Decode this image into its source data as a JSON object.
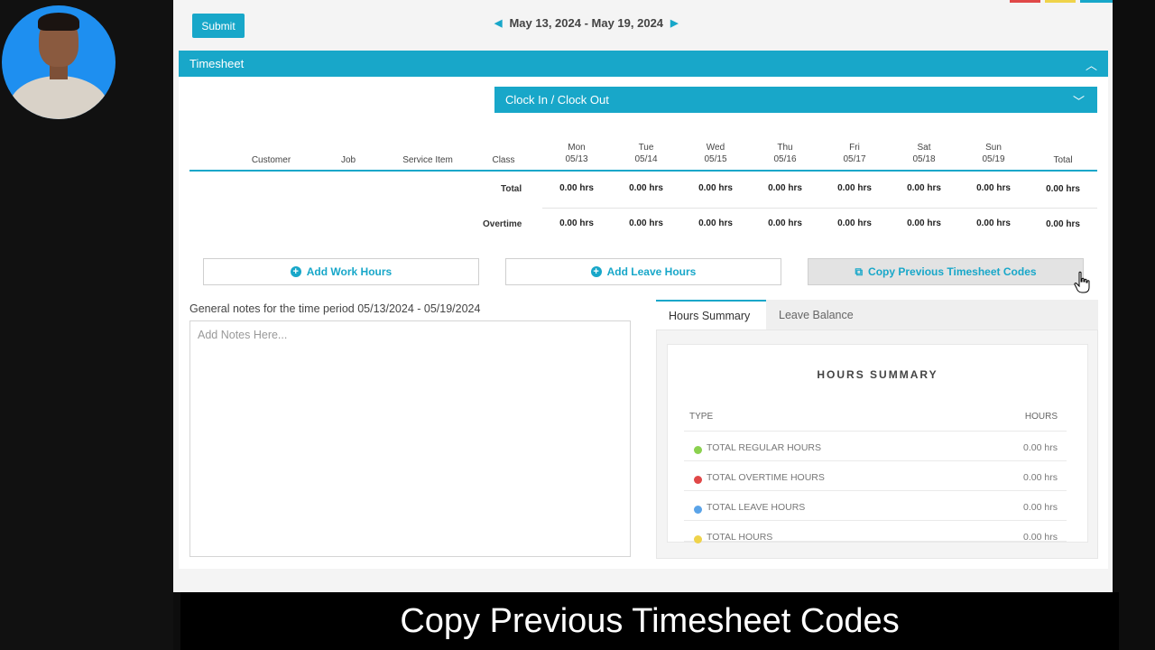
{
  "toolbar": {
    "submit_label": "Submit",
    "date_range": "May 13, 2024 - May 19, 2024"
  },
  "timesheet": {
    "title": "Timesheet",
    "clock_label": "Clock In / Clock Out",
    "columns": {
      "customer": "Customer",
      "job": "Job",
      "service_item": "Service Item",
      "class": "Class",
      "days": [
        {
          "day": "Mon",
          "date": "05/13"
        },
        {
          "day": "Tue",
          "date": "05/14"
        },
        {
          "day": "Wed",
          "date": "05/15"
        },
        {
          "day": "Thu",
          "date": "05/16"
        },
        {
          "day": "Fri",
          "date": "05/17"
        },
        {
          "day": "Sat",
          "date": "05/18"
        },
        {
          "day": "Sun",
          "date": "05/19"
        }
      ],
      "total": "Total"
    },
    "rows": [
      {
        "label": "Total",
        "values": [
          "0.00 hrs",
          "0.00 hrs",
          "0.00 hrs",
          "0.00 hrs",
          "0.00 hrs",
          "0.00 hrs",
          "0.00 hrs",
          "0.00 hrs"
        ]
      },
      {
        "label": "Overtime",
        "values": [
          "0.00 hrs",
          "0.00 hrs",
          "0.00 hrs",
          "0.00 hrs",
          "0.00 hrs",
          "0.00 hrs",
          "0.00 hrs",
          "0.00 hrs"
        ]
      }
    ],
    "actions": {
      "add_work": "Add Work Hours",
      "add_leave": "Add Leave Hours",
      "copy_previous": "Copy Previous Timesheet Codes"
    },
    "notes": {
      "label": "General notes for the time period 05/13/2024 - 05/19/2024",
      "placeholder": "Add Notes Here..."
    }
  },
  "summary": {
    "tabs": [
      "Hours Summary",
      "Leave Balance"
    ],
    "title": "HOURS SUMMARY",
    "head_type": "TYPE",
    "head_hours": "HOURS",
    "rows": [
      {
        "label": "TOTAL REGULAR HOURS",
        "value": "0.00 hrs",
        "color": "#8bd14f"
      },
      {
        "label": "TOTAL OVERTIME HOURS",
        "value": "0.00 hrs",
        "color": "#e04848"
      },
      {
        "label": "TOTAL LEAVE HOURS",
        "value": "0.00 hrs",
        "color": "#5aa3e8"
      },
      {
        "label": "TOTAL HOURS",
        "value": "0.00 hrs",
        "color": "#efd34a"
      }
    ]
  },
  "caption": "Copy Previous Timesheet Codes"
}
